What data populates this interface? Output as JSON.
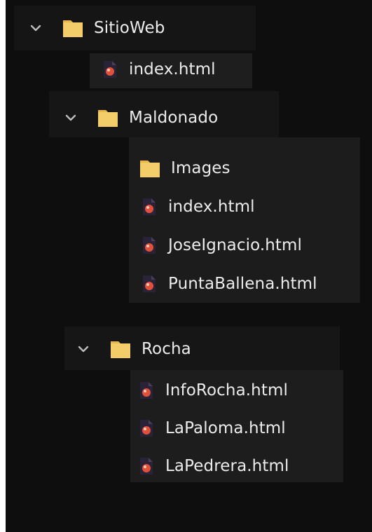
{
  "tree": {
    "root": {
      "label": "SitioWeb",
      "expanded": true,
      "files": [
        "index.html"
      ],
      "folders": [
        {
          "label": "Maldonado",
          "expanded": true,
          "children": [
            "Images"
          ],
          "files": [
            "index.html",
            "JoseIgnacio.html",
            "PuntaBallena.html"
          ]
        },
        {
          "label": "Rocha",
          "expanded": true,
          "files": [
            "InfoRocha.html",
            "LaPaloma.html",
            "LaPedrera.html"
          ]
        }
      ]
    }
  },
  "icons": {
    "chevron": "chevron-down-icon",
    "folder": "folder-icon",
    "file": "html-file-icon"
  },
  "colors": {
    "background": "#0e0e0e",
    "text": "#ececec",
    "folder": "#f4cd6b",
    "file_accent": "#e0503a"
  }
}
